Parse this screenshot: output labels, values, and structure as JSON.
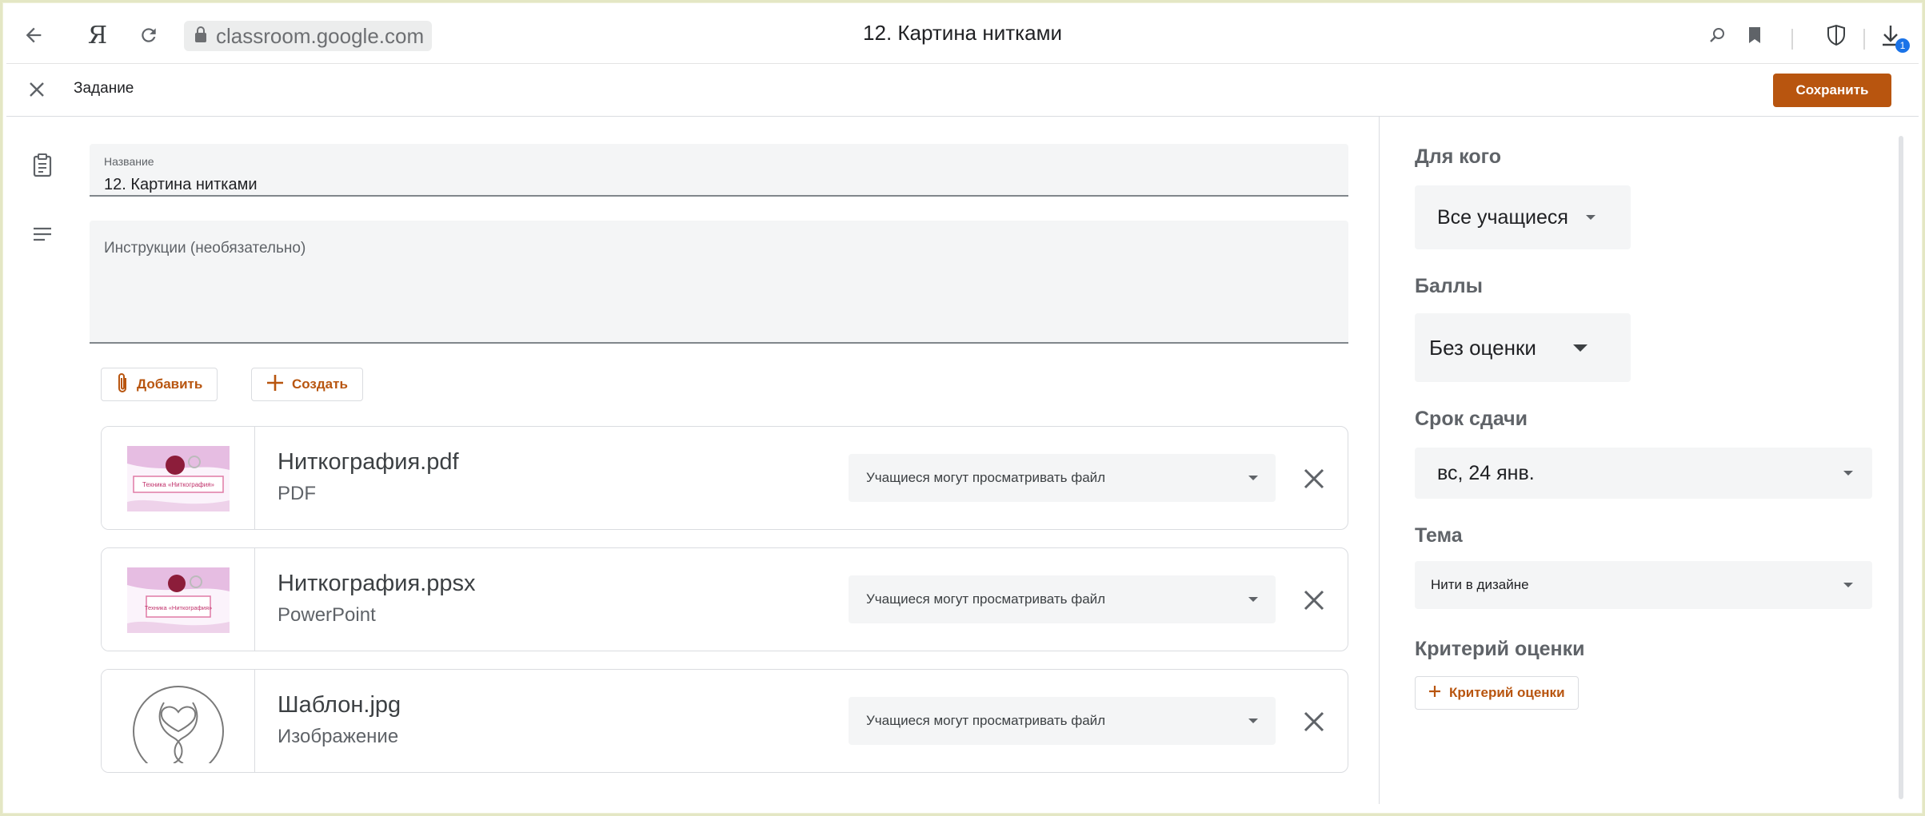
{
  "browser": {
    "url": "classroom.google.com",
    "tab_title": "12. Картина нитками",
    "browser_logo": "Я",
    "download_count": "1"
  },
  "header": {
    "title": "Задание",
    "save_label": "Сохранить"
  },
  "form": {
    "title_label": "Название",
    "title_value": "12. Картина нитками",
    "instructions_placeholder": "Инструкции (необязательно)"
  },
  "actions": {
    "add_label": "Добавить",
    "create_label": "Создать"
  },
  "attachments": [
    {
      "name": "Ниткография.pdf",
      "type": "PDF",
      "permission": "Учащиеся могут просматривать файл",
      "thumb_text": "Техника «Ниткография»"
    },
    {
      "name": "Ниткография.ppsx",
      "type": "PowerPoint",
      "permission": "Учащиеся могут просматривать файл",
      "thumb_text": "Техника «Ниткография»"
    },
    {
      "name": "Шаблон.jpg",
      "type": "Изображение",
      "permission": "Учащиеся могут просматривать файл"
    }
  ],
  "settings": {
    "for_label": "Для кого",
    "for_value": "Все учащиеся",
    "points_label": "Баллы",
    "points_value": "Без оценки",
    "due_label": "Срок сдачи",
    "due_value": "вс, 24 янв.",
    "topic_label": "Тема",
    "topic_value": "Нити в дизайне",
    "rubric_label": "Критерий оценки",
    "rubric_button": "Критерий оценки"
  },
  "colors": {
    "accent": "#b8550f",
    "field_bg": "#f4f5f6",
    "badge": "#1a73e8"
  }
}
